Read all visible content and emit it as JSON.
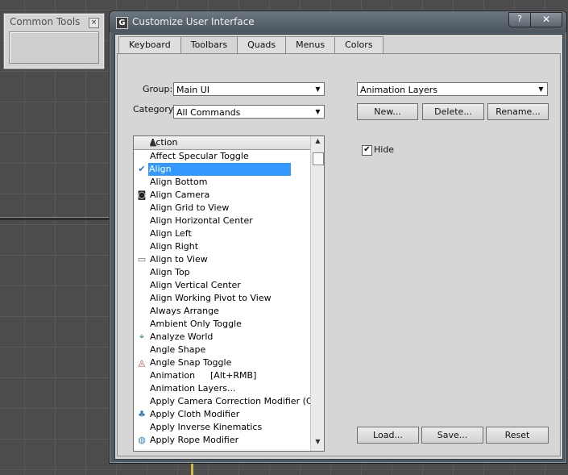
{
  "common_tools": {
    "title": "Common Tools",
    "close_glyph": "×"
  },
  "dialog": {
    "title": "Customize User Interface",
    "app_icon_glyph": "G",
    "help_glyph": "?",
    "close_glyph": "✕",
    "tabs": [
      "Keyboard",
      "Toolbars",
      "Quads",
      "Menus",
      "Colors"
    ],
    "active_tab": "Toolbars"
  },
  "left": {
    "group_label": "Group:",
    "group_value": "Main UI",
    "category_label": "Category:",
    "category_value": "All Commands",
    "list_header": "Action",
    "items": [
      {
        "label": "Affect Specular Toggle",
        "icon": "",
        "key": ""
      },
      {
        "label": "Align",
        "icon": "align-icon",
        "key": "",
        "selected": true
      },
      {
        "label": "Align Bottom",
        "icon": "",
        "key": ""
      },
      {
        "label": "Align Camera",
        "icon": "camera-icon",
        "key": ""
      },
      {
        "label": "Align Grid to View",
        "icon": "",
        "key": ""
      },
      {
        "label": "Align Horizontal Center",
        "icon": "",
        "key": ""
      },
      {
        "label": "Align Left",
        "icon": "",
        "key": ""
      },
      {
        "label": "Align Right",
        "icon": "",
        "key": ""
      },
      {
        "label": "Align to View",
        "icon": "view-align-icon",
        "key": ""
      },
      {
        "label": "Align Top",
        "icon": "",
        "key": ""
      },
      {
        "label": "Align Vertical Center",
        "icon": "",
        "key": ""
      },
      {
        "label": "Align Working Pivot to View",
        "icon": "",
        "key": ""
      },
      {
        "label": "Always Arrange",
        "icon": "",
        "key": ""
      },
      {
        "label": "Ambient Only Toggle",
        "icon": "",
        "key": ""
      },
      {
        "label": "Analyze World",
        "icon": "analyze-world-icon",
        "key": ""
      },
      {
        "label": "Angle Shape",
        "icon": "",
        "key": ""
      },
      {
        "label": "Angle Snap Toggle",
        "icon": "angle-snap-icon",
        "key": ""
      },
      {
        "label": "Animation",
        "icon": "",
        "key": "[Alt+RMB]"
      },
      {
        "label": "Animation Layers...",
        "icon": "",
        "key": ""
      },
      {
        "label": "Apply Camera Correction Modifier (Cont...",
        "icon": "",
        "key": ""
      },
      {
        "label": "Apply Cloth Modifier",
        "icon": "cloth-icon",
        "key": ""
      },
      {
        "label": "Apply Inverse Kinematics",
        "icon": "",
        "key": ""
      },
      {
        "label": "Apply Rope Modifier",
        "icon": "rope-icon",
        "key": ""
      }
    ]
  },
  "right": {
    "toolbar_value": "Animation Layers",
    "new_label": "New...",
    "delete_label": "Delete...",
    "rename_label": "Rename...",
    "hide_label": "Hide",
    "hide_checked": true,
    "load_label": "Load...",
    "save_label": "Save...",
    "reset_label": "Reset"
  }
}
